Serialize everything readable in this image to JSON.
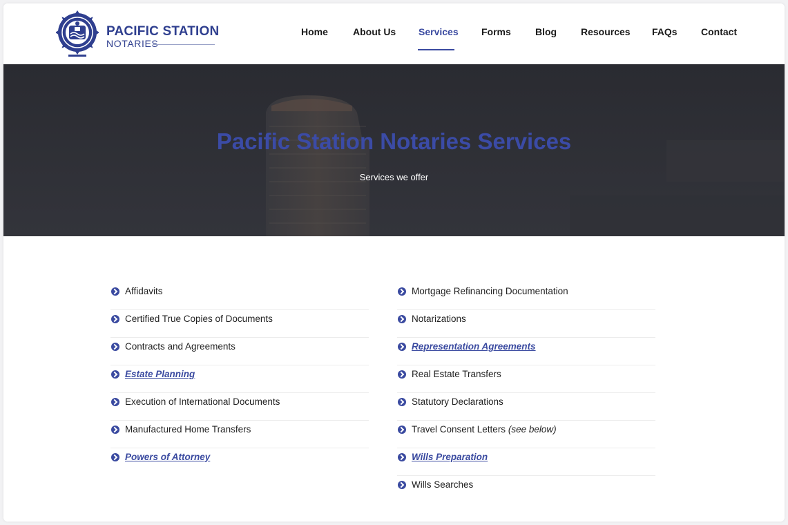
{
  "brand": {
    "title": "PACIFIC STATION",
    "subtitle": "NOTARIES",
    "color": "#2f3f8f"
  },
  "nav": {
    "items": [
      {
        "label": "Home"
      },
      {
        "label": "About Us"
      },
      {
        "label": "Services",
        "active": true
      },
      {
        "label": "Forms"
      },
      {
        "label": "Blog"
      },
      {
        "label": "Resources"
      },
      {
        "label": "FAQs"
      },
      {
        "label": "Contact"
      }
    ]
  },
  "hero": {
    "title": "Pacific Station Notaries Services",
    "subtitle": "Services we offer"
  },
  "services": {
    "left": [
      {
        "label": "Affidavits",
        "link": false
      },
      {
        "label": "Certified True Copies of Documents",
        "link": false
      },
      {
        "label": "Contracts and Agreements",
        "link": false
      },
      {
        "label": "Estate Planning",
        "link": true
      },
      {
        "label": "Execution of International Documents",
        "link": false
      },
      {
        "label": "Manufactured Home Transfers",
        "link": false
      },
      {
        "label": "Powers of Attorney",
        "link": true
      }
    ],
    "right": [
      {
        "label": "Mortgage Refinancing Documentation",
        "link": false
      },
      {
        "label": "Notarizations",
        "link": false
      },
      {
        "label": "Representation Agreements",
        "link": true
      },
      {
        "label": "Real Estate Transfers",
        "link": false
      },
      {
        "label": "Statutory Declarations",
        "link": false
      },
      {
        "label": "Travel Consent Letters",
        "note": "(see below)",
        "link": false
      },
      {
        "label": "Wills Preparation",
        "link": true
      },
      {
        "label": "Wills Searches",
        "link": false
      }
    ]
  },
  "colors": {
    "accent": "#3a4aa0",
    "hero_bg": "#2b2c33"
  }
}
